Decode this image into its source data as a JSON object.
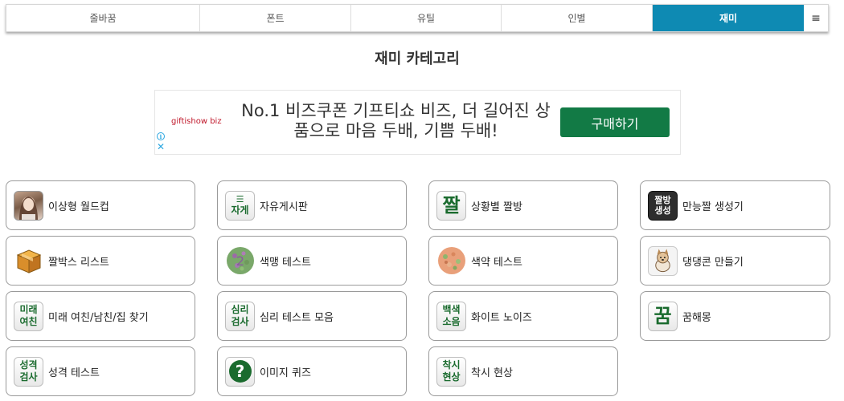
{
  "nav": {
    "tabs": [
      {
        "label": "줄바꿈"
      },
      {
        "label": "폰트"
      },
      {
        "label": "유틸"
      },
      {
        "label": "인별"
      },
      {
        "label": "재미"
      }
    ],
    "menu_icon": "hamburger-menu-icon",
    "menu_glyph": "≡",
    "active_color": "#0e8ab3"
  },
  "page_title": "재미 카테고리",
  "ad": {
    "brand": "giftishow biz",
    "text": "No.1 비즈쿠폰 기프티쇼 비즈, 더 길어진 상품으로 마음 두배, 기쁨 두배!",
    "button": "구매하기",
    "info_glyph": "i",
    "close_glyph": "✕",
    "button_color": "#127a45"
  },
  "cards": [
    {
      "label": "이상형 월드컵",
      "icon": "person-photo-icon"
    },
    {
      "label": "자유게시판",
      "icon": "list-icon",
      "icon_text": "자게",
      "icon_glyph": "☰"
    },
    {
      "label": "상황별 짤방",
      "icon": "jjal-icon",
      "icon_text": "짤"
    },
    {
      "label": "만능짤 생성기",
      "icon": "jjalbang-icon",
      "icon_text_1": "짤방",
      "icon_text_2": "생성"
    },
    {
      "label": "짤박스 리스트",
      "icon": "box-icon"
    },
    {
      "label": "색맹 테스트",
      "icon": "color-blind-plate-icon"
    },
    {
      "label": "색약 테스트",
      "icon": "color-weak-plate-icon"
    },
    {
      "label": "댕댕콘 만들기",
      "icon": "dog-icon"
    },
    {
      "label": "미래 여친/남친/집 찾기",
      "icon": "future-icon",
      "icon_text_1": "미래",
      "icon_text_2": "여친"
    },
    {
      "label": "심리 테스트 모음",
      "icon": "psych-icon",
      "icon_text_1": "심리",
      "icon_text_2": "검사"
    },
    {
      "label": "화이트 노이즈",
      "icon": "noise-icon",
      "icon_text_1": "백색",
      "icon_text_2": "소음"
    },
    {
      "label": "꿈해몽",
      "icon": "dream-icon",
      "icon_text": "꿈"
    },
    {
      "label": "성격 테스트",
      "icon": "personality-icon",
      "icon_text_1": "성격",
      "icon_text_2": "검사"
    },
    {
      "label": "이미지 퀴즈",
      "icon": "question-icon",
      "icon_glyph": "?"
    },
    {
      "label": "착시 현상",
      "icon": "illusion-icon",
      "icon_text_1": "착시",
      "icon_text_2": "현상"
    }
  ]
}
